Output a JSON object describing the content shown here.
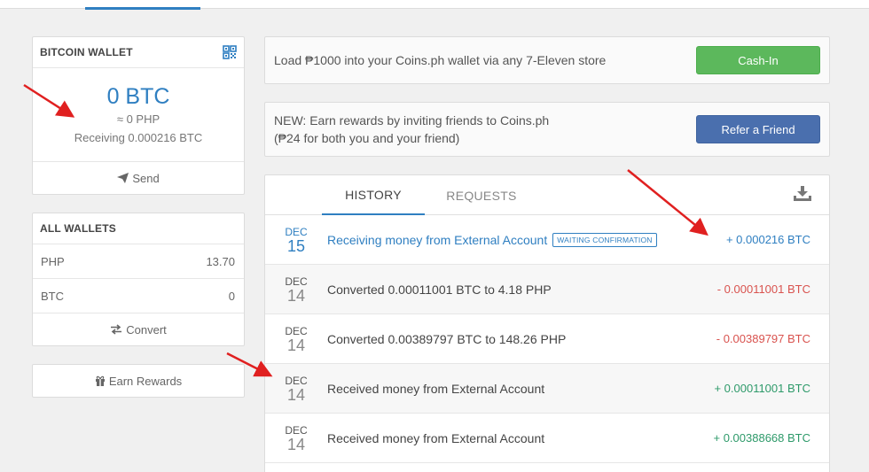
{
  "bitcoin_wallet": {
    "title": "BITCOIN WALLET",
    "balance": "0 BTC",
    "approx": "≈ 0 PHP",
    "receiving": "Receiving 0.000216 BTC",
    "send_label": "Send",
    "qr_icon": "qr-code-icon"
  },
  "all_wallets": {
    "title": "ALL WALLETS",
    "rows": [
      {
        "currency": "PHP",
        "amount": "13.70"
      },
      {
        "currency": "BTC",
        "amount": "0"
      }
    ],
    "convert_label": "Convert"
  },
  "earn_rewards_label": "Earn Rewards",
  "promos": [
    {
      "text": "Load ₱1000 into your Coins.ph wallet via any 7-Eleven store",
      "button": "Cash-In"
    },
    {
      "text_line1": "NEW: Earn rewards by inviting friends to Coins.ph",
      "text_line2": "(₱24 for both you and your friend)",
      "button": "Refer a Friend"
    }
  ],
  "history": {
    "tabs": [
      "HISTORY",
      "REQUESTS"
    ],
    "active_tab": "HISTORY",
    "rows": [
      {
        "month": "DEC",
        "day": "15",
        "desc": "Receiving money from External Account",
        "badge": "WAITING CONFIRMATION",
        "amount": "+ 0.000216 BTC",
        "status": "pending"
      },
      {
        "month": "DEC",
        "day": "14",
        "desc": "Converted 0.00011001 BTC to 4.18 PHP",
        "amount": "- 0.00011001 BTC",
        "status": "debit"
      },
      {
        "month": "DEC",
        "day": "14",
        "desc": "Converted 0.00389797 BTC to 148.26 PHP",
        "amount": "- 0.00389797 BTC",
        "status": "debit"
      },
      {
        "month": "DEC",
        "day": "14",
        "desc": "Received money from External Account",
        "amount": "+ 0.00011001 BTC",
        "status": "credit"
      },
      {
        "month": "DEC",
        "day": "14",
        "desc": "Received money from External Account",
        "amount": "+ 0.00388668 BTC",
        "status": "credit"
      }
    ]
  },
  "colors": {
    "accent": "#2f7fc1",
    "cash_in": "#5cb85c",
    "refer": "#4a6fae",
    "debit": "#d9534f",
    "credit": "#2e9a6a",
    "annotation_arrow": "#e02020"
  }
}
